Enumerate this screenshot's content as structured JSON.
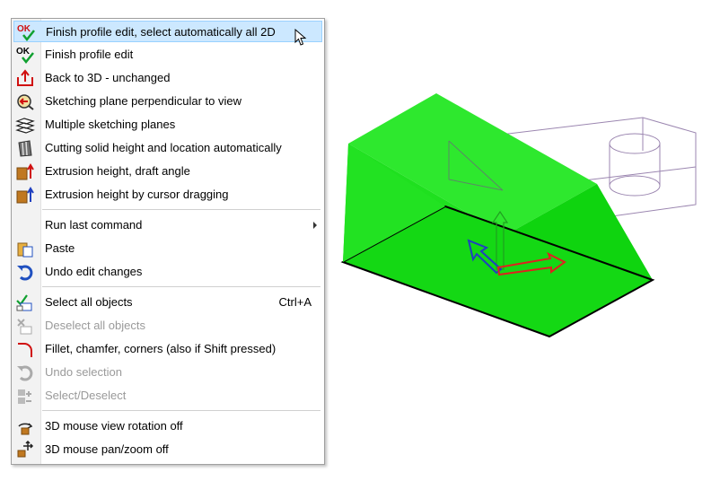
{
  "menu": {
    "items": [
      {
        "label": "Finish profile edit, select automatically all 2D",
        "icon": "ok-select-icon",
        "enabled": true,
        "highlighted": true
      },
      {
        "label": "Finish profile edit",
        "icon": "ok-icon",
        "enabled": true
      },
      {
        "label": "Back to 3D - unchanged",
        "icon": "back-to-3d-icon",
        "enabled": true
      },
      {
        "label": "Sketching plane perpendicular to view",
        "icon": "sketch-plane-view-icon",
        "enabled": true
      },
      {
        "label": "Multiple sketching planes",
        "icon": "multiple-planes-icon",
        "enabled": true
      },
      {
        "label": "Cutting solid height and location automatically",
        "icon": "cutting-solid-icon",
        "enabled": true
      },
      {
        "label": "Extrusion height, draft angle",
        "icon": "extrusion-draft-icon",
        "enabled": true
      },
      {
        "label": "Extrusion height by cursor dragging",
        "icon": "extrusion-drag-icon",
        "enabled": true
      },
      {
        "label": "Run last command",
        "icon": "",
        "enabled": true,
        "submenu": true
      },
      {
        "label": "Paste",
        "icon": "paste-icon",
        "enabled": true
      },
      {
        "label": "Undo edit changes",
        "icon": "undo-icon",
        "enabled": true
      },
      {
        "label": "Select all objects",
        "icon": "select-all-icon",
        "enabled": true,
        "shortcut": "Ctrl+A"
      },
      {
        "label": "Deselect all objects",
        "icon": "deselect-all-icon",
        "enabled": false
      },
      {
        "label": "Fillet, chamfer, corners (also if Shift pressed)",
        "icon": "fillet-icon",
        "enabled": true
      },
      {
        "label": "Undo selection",
        "icon": "undo-selection-icon",
        "enabled": false
      },
      {
        "label": "Select/Deselect",
        "icon": "select-deselect-icon",
        "enabled": false
      },
      {
        "label": "3D mouse view rotation off",
        "icon": "mouse-rotation-icon",
        "enabled": true
      },
      {
        "label": "3D mouse pan/zoom off",
        "icon": "mouse-pan-zoom-icon",
        "enabled": true
      }
    ]
  },
  "icon_text": {
    "ok": "OK"
  },
  "colors": {
    "solid_top": "#2ee82e",
    "solid_front": "#1fe01f",
    "solid_side": "#0ccc0c",
    "ghost": "#9b86b0",
    "arrow_red": "#e02020",
    "arrow_blue": "#2040c0"
  }
}
